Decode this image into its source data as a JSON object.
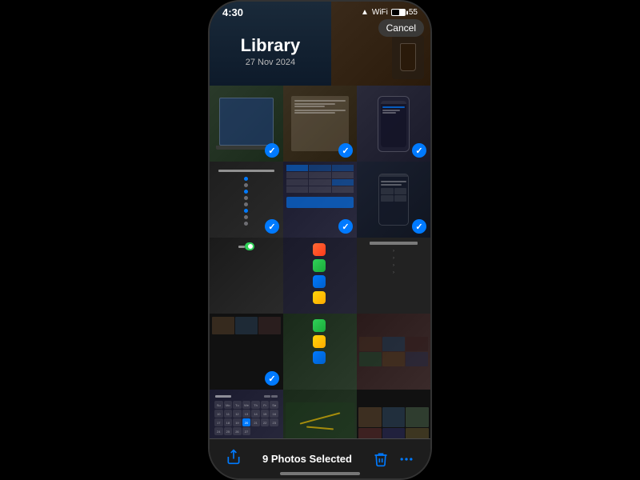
{
  "status_bar": {
    "time": "4:30",
    "wifi": "WiFi",
    "battery": "55"
  },
  "hero": {
    "title": "Library",
    "date": "27 Nov 2024"
  },
  "cancel_btn": "Cancel",
  "bottom_bar": {
    "selected_label": "9 Photos Selected",
    "share_icon": "share",
    "delete_icon": "delete",
    "more_icon": "more"
  },
  "thumbnails": [
    {
      "id": "laptop-1",
      "checked": true,
      "type": "laptop"
    },
    {
      "id": "notes-1",
      "checked": true,
      "type": "notes"
    },
    {
      "id": "iphone-1",
      "checked": true,
      "type": "iphone"
    },
    {
      "id": "sidebar-1",
      "checked": true,
      "type": "sidebar"
    },
    {
      "id": "spreadsheet-1",
      "checked": true,
      "type": "spreadsheet"
    },
    {
      "id": "iphone-2",
      "checked": true,
      "type": "iphone"
    },
    {
      "id": "settings-1",
      "checked": false,
      "type": "settings"
    },
    {
      "id": "apps-1",
      "checked": false,
      "type": "apps"
    },
    {
      "id": "utilities-1",
      "checked": false,
      "type": "utilities"
    },
    {
      "id": "albums-1",
      "checked": true,
      "type": "albums"
    },
    {
      "id": "green-1",
      "checked": false,
      "type": "green"
    },
    {
      "id": "photos-1",
      "checked": false,
      "type": "photos"
    },
    {
      "id": "calendar-1",
      "checked": false,
      "type": "calendar"
    },
    {
      "id": "maps-1",
      "checked": false,
      "type": "maps"
    },
    {
      "id": "photos-grid",
      "checked": false,
      "type": "photos-grid"
    }
  ]
}
